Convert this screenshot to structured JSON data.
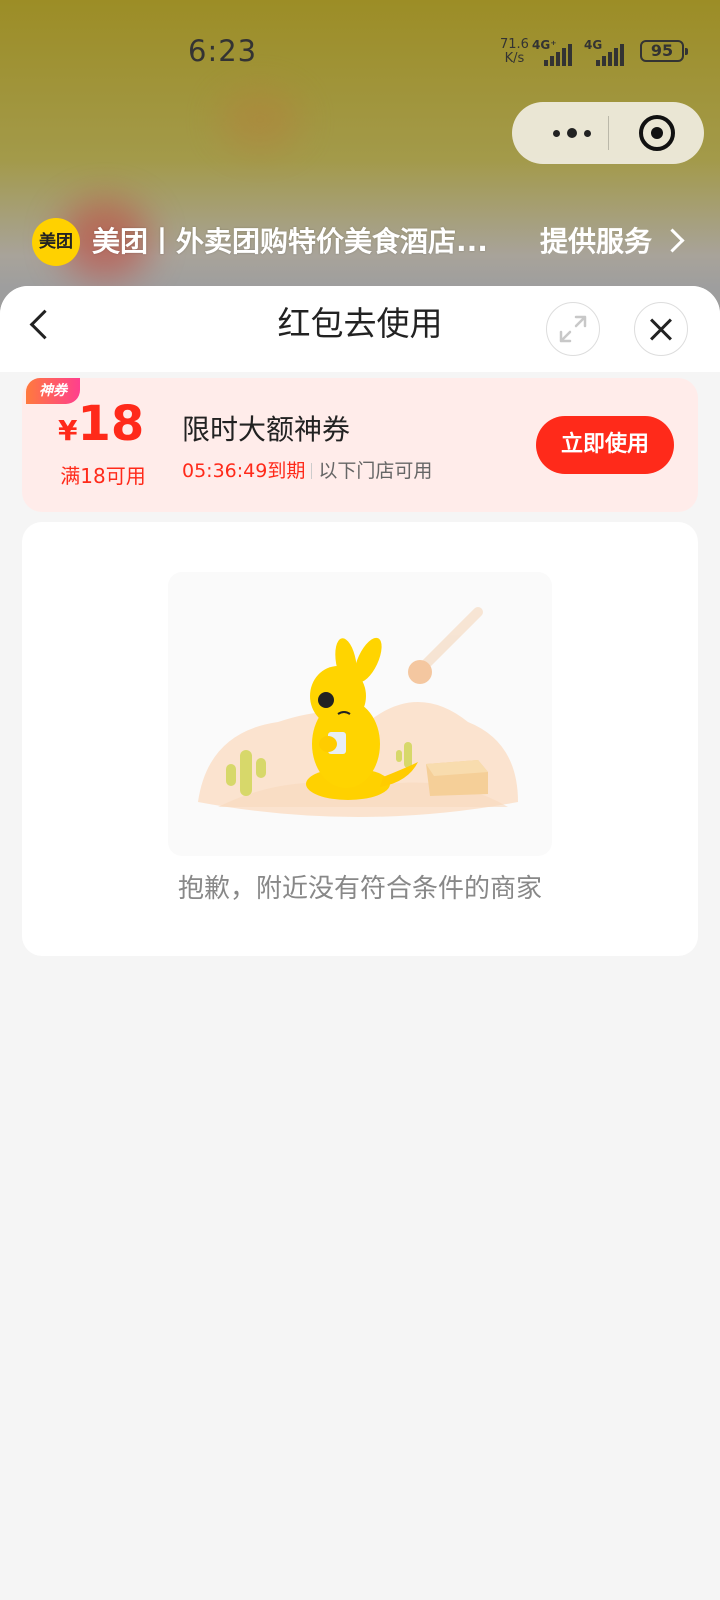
{
  "status_bar": {
    "time": "6:23",
    "net_speed_value": "71.6",
    "net_speed_unit": "K/s",
    "signal_1_label": "4G⁺",
    "signal_2_label": "4G",
    "battery": "95"
  },
  "mini_program": {
    "logo_text": "美团",
    "title": "美团丨外卖团购特价美食酒店...",
    "service_label": "提供服务"
  },
  "sheet": {
    "title": "红包去使用"
  },
  "coupon": {
    "tag": "神券",
    "currency": "¥",
    "amount": "18",
    "condition": "满18可用",
    "title": "限时大额神券",
    "expiry": "05:36:49到期",
    "scope": "以下门店可用",
    "use_button": "立即使用",
    "accent_color": "#ff2a1a"
  },
  "empty_state": {
    "message": "抱歉，附近没有符合条件的商家"
  }
}
